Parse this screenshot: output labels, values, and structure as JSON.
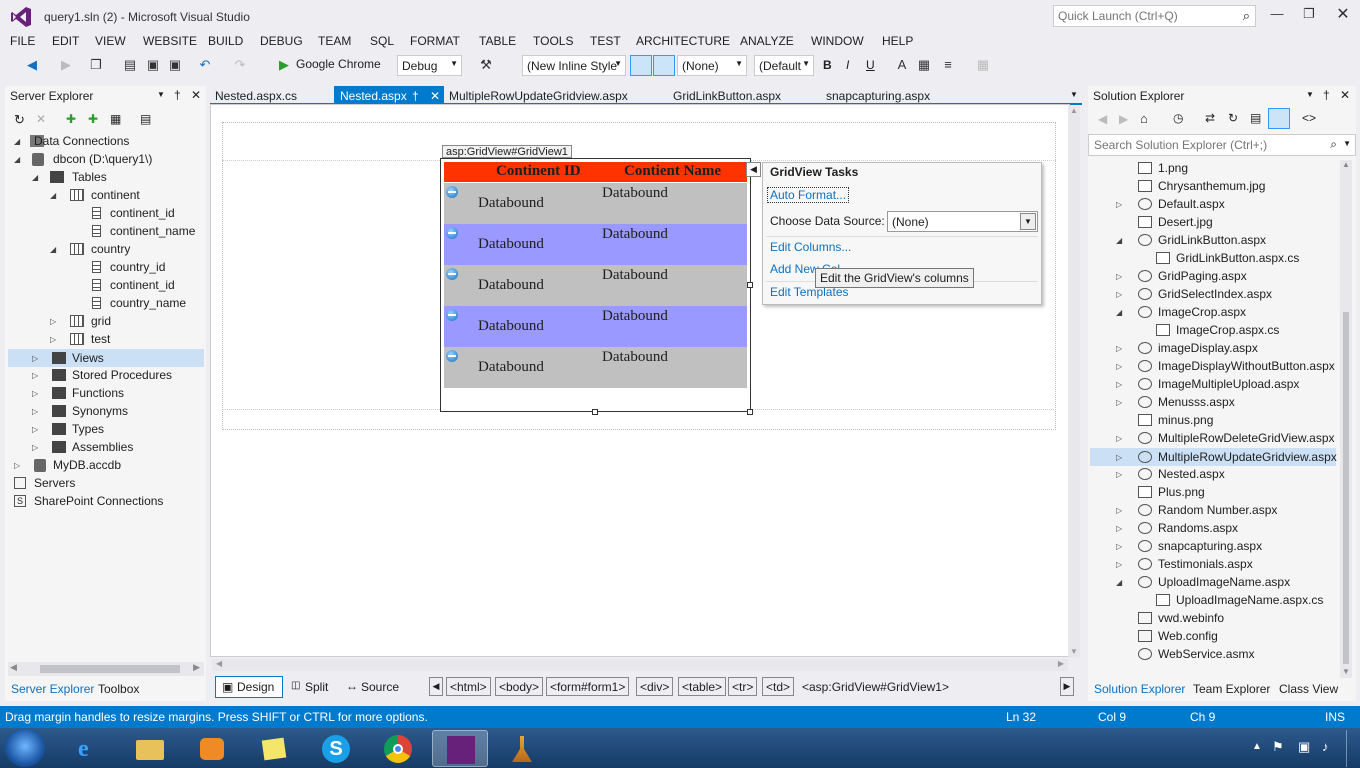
{
  "window": {
    "title": "query1.sln (2) - Microsoft Visual Studio",
    "quick_launch_placeholder": "Quick Launch (Ctrl+Q)"
  },
  "menu": [
    "FILE",
    "EDIT",
    "VIEW",
    "WEBSITE",
    "BUILD",
    "DEBUG",
    "TEAM",
    "SQL",
    "FORMAT",
    "TABLE",
    "TOOLS",
    "TEST",
    "ARCHITECTURE",
    "ANALYZE",
    "WINDOW",
    "HELP"
  ],
  "toolbar": {
    "browser": "Google Chrome",
    "config": "Debug",
    "style": "(New Inline Style",
    "target_rule": "(None)",
    "font": "(Default",
    "bold": "B",
    "italic": "I",
    "underline": "U"
  },
  "server_explorer": {
    "title": "Server Explorer",
    "tree": [
      {
        "label": "Data Connections"
      },
      {
        "label": "dbcon (D:\\query1\\)"
      },
      {
        "label": "Tables"
      },
      {
        "label": "continent"
      },
      {
        "label": "continent_id"
      },
      {
        "label": "continent_name"
      },
      {
        "label": "country"
      },
      {
        "label": "country_id"
      },
      {
        "label": "continent_id"
      },
      {
        "label": "country_name"
      },
      {
        "label": "grid"
      },
      {
        "label": "test"
      },
      {
        "label": "Views"
      },
      {
        "label": "Stored Procedures"
      },
      {
        "label": "Functions"
      },
      {
        "label": "Synonyms"
      },
      {
        "label": "Types"
      },
      {
        "label": "Assemblies"
      },
      {
        "label": "MyDB.accdb"
      },
      {
        "label": "Servers"
      },
      {
        "label": "SharePoint Connections"
      }
    ],
    "bottom_tabs": [
      "Server Explorer",
      "Toolbox"
    ]
  },
  "editor": {
    "tabs": [
      "Nested.aspx.cs",
      "Nested.aspx",
      "MultipleRowUpdateGridview.aspx",
      "GridLinkButton.aspx",
      "snapcapturing.aspx"
    ],
    "grid_tag": "asp:GridView#GridView1",
    "grid_headers": [
      "Continent ID",
      "Contient Name"
    ],
    "grid_cells": [
      "Databound",
      "Databound",
      "Databound",
      "Databound",
      "Databound",
      "Databound",
      "Databound",
      "Databound",
      "Databound",
      "Databound"
    ],
    "view_modes": [
      "Design",
      "Split",
      "Source"
    ],
    "breadcrumbs": [
      "<html>",
      "<body>",
      "<form#form1>",
      "<div>",
      "<table>",
      "<tr>",
      "<td>",
      "<asp:GridView#GridView1>"
    ]
  },
  "tasks_panel": {
    "title": "GridView Tasks",
    "auto_format": "Auto Format...",
    "choose_source_label": "Choose Data Source:",
    "choose_source_value": "(None)",
    "edit_columns": "Edit Columns...",
    "add_new": "Add New Col",
    "edit_templates": "Edit Templates",
    "tooltip": "Edit the GridView's columns"
  },
  "solution_explorer": {
    "title": "Solution Explorer",
    "search_placeholder": "Search Solution Explorer (Ctrl+;)",
    "items": [
      {
        "label": "1.png"
      },
      {
        "label": "Chrysanthemum.jpg"
      },
      {
        "label": "Default.aspx"
      },
      {
        "label": "Desert.jpg"
      },
      {
        "label": "GridLinkButton.aspx"
      },
      {
        "label": "GridLinkButton.aspx.cs"
      },
      {
        "label": "GridPaging.aspx"
      },
      {
        "label": "GridSelectIndex.aspx"
      },
      {
        "label": "ImageCrop.aspx"
      },
      {
        "label": "ImageCrop.aspx.cs"
      },
      {
        "label": "imageDisplay.aspx"
      },
      {
        "label": "ImageDisplayWithoutButton.aspx"
      },
      {
        "label": "ImageMultipleUpload.aspx"
      },
      {
        "label": "Menusss.aspx"
      },
      {
        "label": "minus.png"
      },
      {
        "label": "MultipleRowDeleteGridView.aspx"
      },
      {
        "label": "MultipleRowUpdateGridview.aspx"
      },
      {
        "label": "Nested.aspx"
      },
      {
        "label": "Plus.png"
      },
      {
        "label": "Random Number.aspx"
      },
      {
        "label": "Randoms.aspx"
      },
      {
        "label": "snapcapturing.aspx"
      },
      {
        "label": "Testimonials.aspx"
      },
      {
        "label": "UploadImageName.aspx"
      },
      {
        "label": "UploadImageName.aspx.cs"
      },
      {
        "label": "vwd.webinfo"
      },
      {
        "label": "Web.config"
      },
      {
        "label": "WebService.asmx"
      }
    ],
    "bottom_tabs": [
      "Solution Explorer",
      "Team Explorer",
      "Class View"
    ]
  },
  "status": {
    "message": "Drag margin handles to resize margins. Press SHIFT or CTRL for more options.",
    "line": "Ln 32",
    "col": "Col 9",
    "ch": "Ch 9",
    "mode": "INS"
  },
  "colors": {
    "accent": "#007acc",
    "grid_header": "#ff3300",
    "grid_row_gray": "#c0c0c0",
    "grid_row_blue": "#9999ff"
  }
}
